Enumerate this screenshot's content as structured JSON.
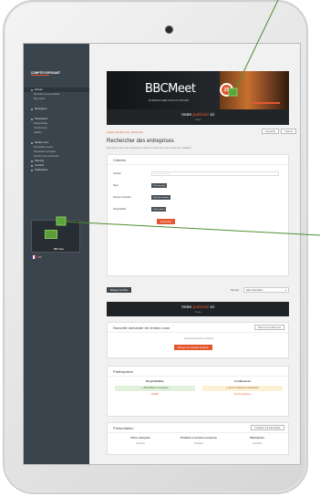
{
  "sidebar": {
    "brand": "COMPTE EXPOSANT",
    "items": [
      {
        "label": "Accueil",
        "type": "active"
      },
      {
        "label": "Ma fiche et mes produits",
        "type": "sub"
      },
      {
        "label": "Mon stand",
        "type": "sub"
      },
      {
        "label": "",
        "type": "gap"
      },
      {
        "label": "Messagerie",
        "type": "item"
      },
      {
        "label": "",
        "type": "gap"
      },
      {
        "label": "Participation",
        "type": "item"
      },
      {
        "label": "Disponibilités",
        "type": "sub"
      },
      {
        "label": "Conférences",
        "type": "sub"
      },
      {
        "label": "Ateliers",
        "type": "sub"
      },
      {
        "label": "",
        "type": "gap"
      },
      {
        "label": "Rendez-vous",
        "type": "item"
      },
      {
        "label": "Demandes reçues",
        "type": "sub"
      },
      {
        "label": "Demandes envoyées",
        "type": "sub"
      },
      {
        "label": "Rendez-vous confirmés",
        "type": "sub"
      },
      {
        "label": "Planning",
        "type": "item"
      },
      {
        "label": "Contacts",
        "type": "item"
      },
      {
        "label": "Notifications",
        "type": "item"
      }
    ],
    "ad_label": "BBC Meet",
    "language": "FR"
  },
  "hero": {
    "logo": "BBCMeet",
    "badge": "25",
    "tagline": "BUSINESS MEETINGS PLATFORM"
  },
  "publicite": {
    "prefix": "Votre ",
    "highlight": "publicité",
    "suffix": " ici",
    "sub": "728x90"
  },
  "breadcrumb": "Accueil / Rendez-vous / Rechercher",
  "top_buttons": [
    "Exposants",
    "Visiteurs"
  ],
  "page": {
    "title": "Rechercher des entreprises",
    "subtitle": "Recherchez parmi les exposants et visiteurs inscrits pour vos rendez-vous d'affaires"
  },
  "filters": {
    "title": "Critères",
    "rows": [
      {
        "label": "Société",
        "type": "input",
        "placeholder": "Saisissez un nom"
      },
      {
        "label": "Pays",
        "type": "select",
        "value": "Tous les pays"
      },
      {
        "label": "Secteur d'activité",
        "type": "select",
        "value": "Tous les secteurs"
      },
      {
        "label": "Disponibilité",
        "type": "select",
        "value": "Toutes dates"
      }
    ],
    "submit": "Rechercher"
  },
  "toolbar": {
    "toggle_label": "Masquer les filtres",
    "sort_label": "Trier par :",
    "sort_value": "Date d'inscription"
  },
  "rdv": {
    "title": "Nouvelle demande de rendez-vous",
    "action": "Gérer mes rendez-vous",
    "empty": "Aucune demande en attente",
    "cta": "Envoyer une nouvelle demande"
  },
  "participation": {
    "title": "Participation",
    "col1": {
      "title": "Disponibilités",
      "status": "Disponibilités renseignées",
      "link": "Modifier"
    },
    "col2": {
      "title": "Conférences",
      "status": "Aucune conférence sélectionnée",
      "link": "Voir le programme"
    }
  },
  "presentation": {
    "title": "Présentation",
    "action": "Compléter ma présentation",
    "cols": [
      {
        "title": "Fiche entreprise",
        "value": "Complète"
      },
      {
        "title": "Produits et services proposés",
        "value": "Complète"
      },
      {
        "title": "Participants",
        "value": "Complète"
      }
    ]
  }
}
